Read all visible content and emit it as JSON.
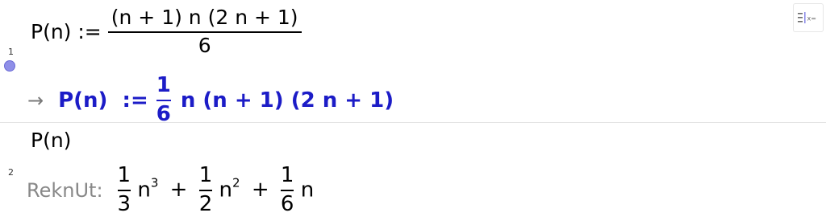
{
  "rows": [
    {
      "number": "1",
      "input": {
        "lhs": "P(n) :=",
        "numerator": "(n + 1) n (2 n + 1)",
        "denominator": "6"
      },
      "output": {
        "arrow": "→",
        "lhs": "P(n)  :=",
        "frac_num": "1",
        "frac_den": "6",
        "rhs": "n (n + 1) (2 n + 1)"
      },
      "marker_color": "#8f8fe8"
    },
    {
      "number": "2",
      "input": {
        "text": "P(n)"
      },
      "output": {
        "label": "ReknUt:",
        "terms": [
          {
            "num": "1",
            "den": "3",
            "var": "n",
            "exp": "3"
          },
          {
            "op": "+",
            "num": "1",
            "den": "2",
            "var": "n",
            "exp": "2"
          },
          {
            "op": "+",
            "num": "1",
            "den": "6",
            "var": "n",
            "exp": ""
          }
        ]
      }
    }
  ],
  "toolbar": {
    "algebra_button_icon": "algebra-input-icon",
    "algebra_button_text": "x="
  },
  "colors": {
    "output_blue": "#1c1cc7",
    "label_gray": "#888888",
    "divider": "#e2e2e2"
  }
}
